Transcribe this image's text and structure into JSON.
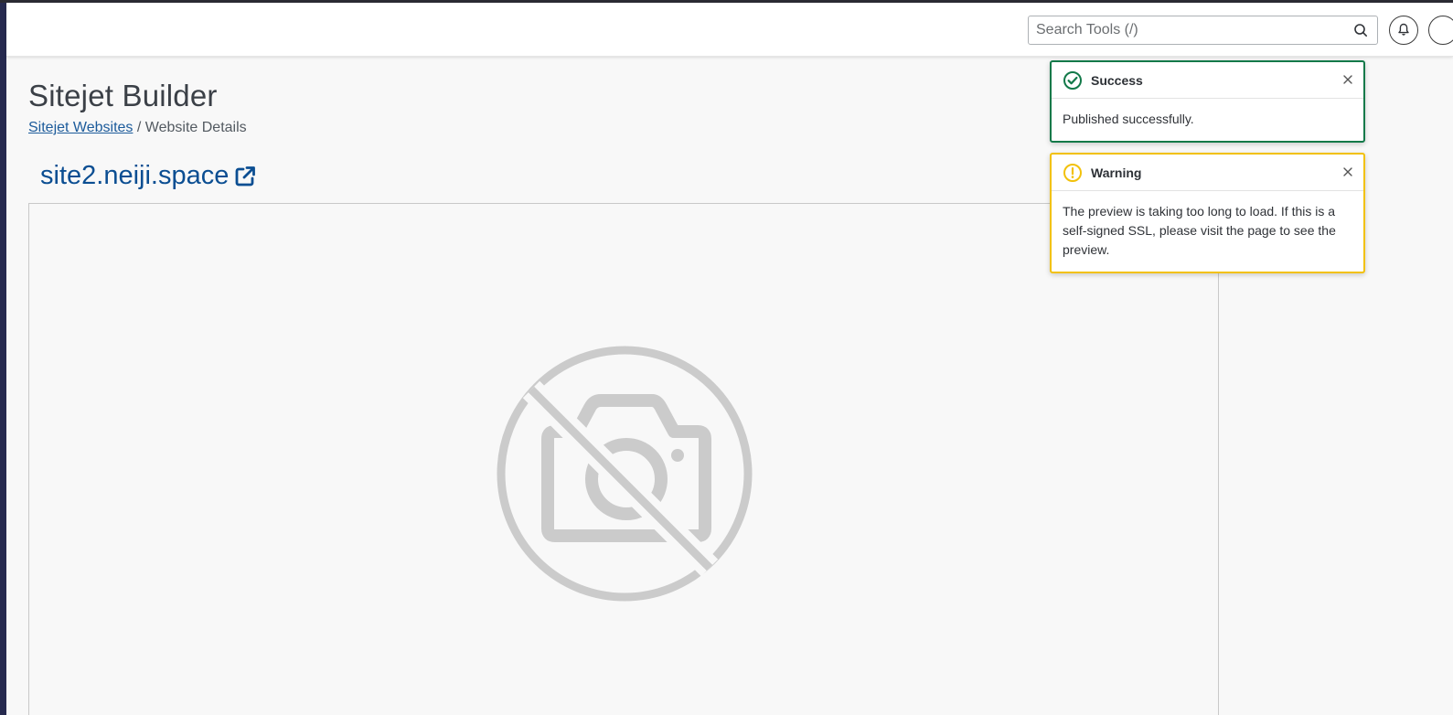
{
  "header": {
    "search": {
      "placeholder": "Search Tools (/)",
      "value": ""
    }
  },
  "page": {
    "title": "Sitejet Builder",
    "breadcrumb": {
      "parent": "Sitejet Websites",
      "separator": "/",
      "current": "Website Details"
    },
    "site_link": "site2.neiji.space"
  },
  "toasts": [
    {
      "type": "success",
      "title": "Success",
      "message": "Published successfully.",
      "color": "#127949"
    },
    {
      "type": "warning",
      "title": "Warning",
      "message": "The preview is taking too long to load. If this is a self-signed SSL, please visit the page to see the preview.",
      "color": "#f2c10b"
    }
  ],
  "icons": {
    "search": "search-icon",
    "bell": "bell-icon",
    "user": "user-icon",
    "external_link": "external-link-icon",
    "no_image": "no-image-icon",
    "success": "check-circle-icon",
    "warning": "exclamation-circle-icon",
    "close": "close-icon"
  },
  "colors": {
    "link": "#0b4e92",
    "breadcrumb_link": "#1c5b9b",
    "success": "#127949",
    "warning": "#f2c10b",
    "sidebar": "#262a4f"
  }
}
